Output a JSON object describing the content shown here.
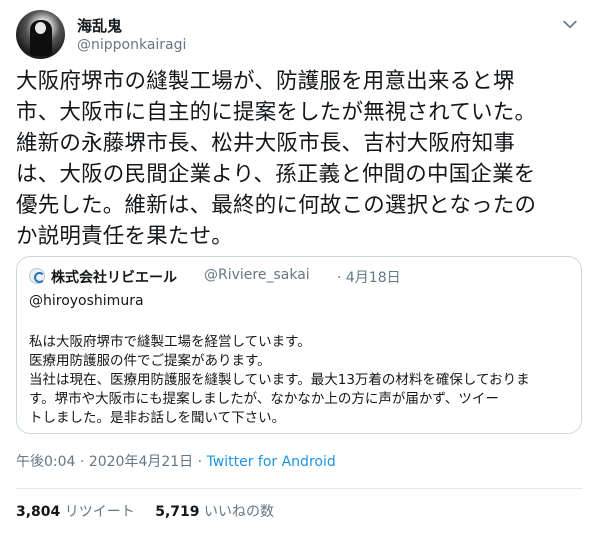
{
  "author": {
    "display_name": "海乱鬼",
    "handle": "@nipponkairagi"
  },
  "tweet_text": "大阪府堺市の縫製工場が、防護服を用意出来ると堺\n市、大阪市に自主的に提案をしたが無視されていた。\n維新の永藤堺市長、松井大阪市長、吉村大阪府知事\nは、大阪の民間企業より、孫正義と仲間の中国企業を\n優先した。維新は、最終的に何故この選択となったの\nか説明責任を果たせ。",
  "quoted_tweet": {
    "name": "株式会社リビエール",
    "handle": "@Riviere_sakai",
    "date": "· 4月18日",
    "mention": "@hiroyoshimura",
    "body_lines": [
      "私は大阪府堺市で縫製工場を経営しています。",
      "医療用防護服の件でご提案があります。",
      "当社は現在、医療用防護服を縫製しています。最大13万着の材料を確保しておりま",
      "す。堺市や大阪市にも提案しましたが、なかなか上の方に声が届かず、ツイー",
      "トしました。是非お話しを聞いて下さい。"
    ]
  },
  "meta": {
    "time": "午後0:04",
    "sep1": " · ",
    "date": "2020年4月21日",
    "sep2": " · ",
    "source": "Twitter for Android"
  },
  "stats": {
    "retweets_count": "3,804",
    "retweets_label": "リツイート",
    "likes_count": "5,719",
    "likes_label": "いいねの数"
  },
  "icons": {
    "menu": "chevron-down-icon",
    "company_logo": "company-logo-icon"
  },
  "colors": {
    "link": "#1b95e0",
    "secondary_text": "#657786",
    "border": "#ccd6dd"
  }
}
